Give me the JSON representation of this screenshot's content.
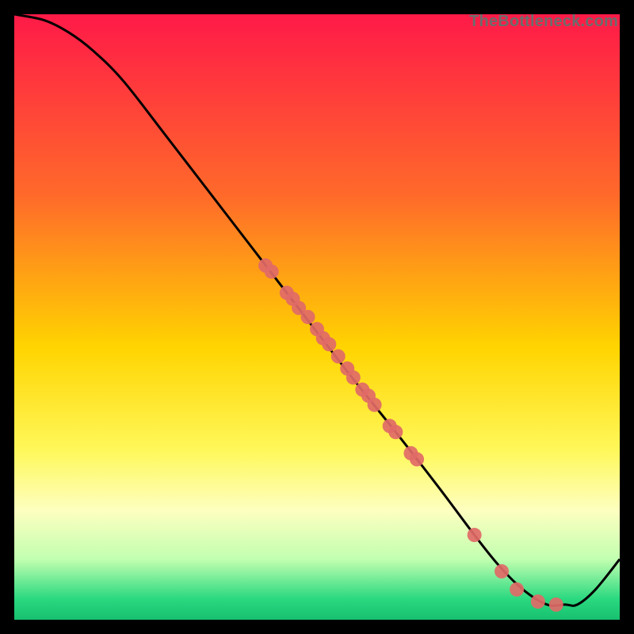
{
  "watermark": "TheBottleneck.com",
  "chart_data": {
    "type": "line",
    "title": "",
    "xlabel": "",
    "ylabel": "",
    "xlim": [
      0,
      100
    ],
    "ylim": [
      0,
      100
    ],
    "background_gradient": {
      "stops": [
        {
          "offset": 0.0,
          "color": "#ff1a48"
        },
        {
          "offset": 0.3,
          "color": "#ff6a2a"
        },
        {
          "offset": 0.55,
          "color": "#ffd400"
        },
        {
          "offset": 0.72,
          "color": "#fff85a"
        },
        {
          "offset": 0.82,
          "color": "#fdffc0"
        },
        {
          "offset": 0.9,
          "color": "#c2ffb0"
        },
        {
          "offset": 0.965,
          "color": "#2bd980"
        },
        {
          "offset": 1.0,
          "color": "#17c06f"
        }
      ]
    },
    "series": [
      {
        "name": "bottleneck-curve",
        "x": [
          0,
          5,
          9,
          13,
          18,
          25,
          35,
          45,
          55,
          63,
          70,
          76,
          80,
          84,
          88,
          91,
          93,
          96,
          100
        ],
        "y": [
          100,
          99,
          97,
          94,
          89,
          80,
          67,
          54,
          41,
          31,
          22,
          14,
          9,
          5,
          2.5,
          2.5,
          2.5,
          5,
          10
        ]
      }
    ],
    "scatter": {
      "name": "sample-points",
      "color": "#e16a67",
      "radius": 9,
      "points": [
        {
          "x": 41.5,
          "y": 58.5
        },
        {
          "x": 42.5,
          "y": 57.5
        },
        {
          "x": 45.0,
          "y": 54.0
        },
        {
          "x": 46.0,
          "y": 53.0
        },
        {
          "x": 47.0,
          "y": 51.5
        },
        {
          "x": 48.5,
          "y": 50.0
        },
        {
          "x": 50.0,
          "y": 48.0
        },
        {
          "x": 51.0,
          "y": 46.5
        },
        {
          "x": 52.0,
          "y": 45.5
        },
        {
          "x": 53.5,
          "y": 43.5
        },
        {
          "x": 55.0,
          "y": 41.5
        },
        {
          "x": 56.0,
          "y": 40.0
        },
        {
          "x": 57.5,
          "y": 38.0
        },
        {
          "x": 58.5,
          "y": 37.0
        },
        {
          "x": 59.5,
          "y": 35.5
        },
        {
          "x": 62.0,
          "y": 32.0
        },
        {
          "x": 63.0,
          "y": 31.0
        },
        {
          "x": 65.5,
          "y": 27.5
        },
        {
          "x": 66.5,
          "y": 26.5
        },
        {
          "x": 76.0,
          "y": 14.0
        },
        {
          "x": 80.5,
          "y": 8.0
        },
        {
          "x": 83.0,
          "y": 5.0
        },
        {
          "x": 86.5,
          "y": 3.0
        },
        {
          "x": 89.5,
          "y": 2.5
        }
      ]
    }
  }
}
